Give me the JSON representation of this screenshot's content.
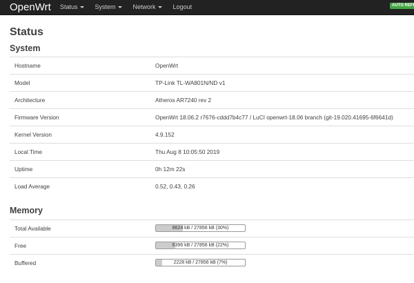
{
  "header": {
    "brand": "OpenWrt",
    "menu": [
      {
        "label": "Status",
        "dropdown": true
      },
      {
        "label": "System",
        "dropdown": true
      },
      {
        "label": "Network",
        "dropdown": true
      },
      {
        "label": "Logout",
        "dropdown": false
      }
    ],
    "auto_refresh_label": "AUTO REFRESH"
  },
  "page": {
    "title": "Status"
  },
  "system": {
    "title": "System",
    "rows": [
      {
        "label": "Hostname",
        "value": "OpenWrt"
      },
      {
        "label": "Model",
        "value": "TP-Link TL-WA801N/ND v1"
      },
      {
        "label": "Architecture",
        "value": "Atheros AR7240 rev 2"
      },
      {
        "label": "Firmware Version",
        "value": "OpenWrt 18.06.2 r7676-cddd7b4c77 / LuCI openwrt-18.06 branch (git-19.020.41695-6f6641d)"
      },
      {
        "label": "Kernel Version",
        "value": "4.9.152"
      },
      {
        "label": "Local Time",
        "value": "Thu Aug 8 10:05:50 2019"
      },
      {
        "label": "Uptime",
        "value": "0h 12m 22s"
      },
      {
        "label": "Load Average",
        "value": "0.52, 0.43, 0.26"
      }
    ]
  },
  "memory": {
    "title": "Memory",
    "rows": [
      {
        "label": "Total Available",
        "text": "8624 kB / 27856 kB (30%)",
        "fraction": 0.3
      },
      {
        "label": "Free",
        "text": "6396 kB / 27856 kB (22%)",
        "fraction": 0.22
      },
      {
        "label": "Buffered",
        "text": "2228 kB / 27856 kB (7%)",
        "fraction": 0.07
      }
    ]
  },
  "colors": {
    "topbar": "#222222",
    "auto_refresh": "#46a546",
    "bar_fill": "#cccccc"
  }
}
